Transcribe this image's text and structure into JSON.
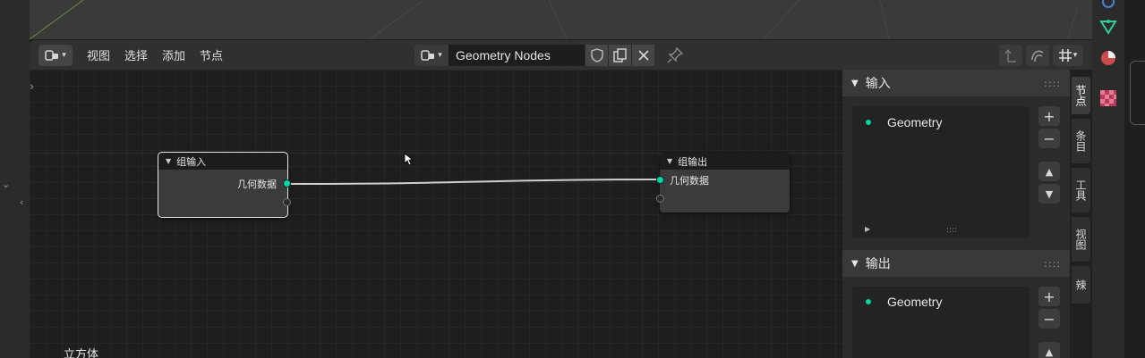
{
  "header": {
    "menus": [
      "视图",
      "选择",
      "添加",
      "节点"
    ],
    "tree_name": "Geometry Nodes"
  },
  "nodes": {
    "group_input": {
      "title": "组输入",
      "output": "几何数据"
    },
    "group_output": {
      "title": "组输出",
      "input": "几何数据"
    }
  },
  "canvas": {
    "label": "立方体"
  },
  "sidebar": {
    "inputs_title": "输入",
    "inputs_item": "Geometry",
    "outputs_title": "输出",
    "outputs_item": "Geometry"
  },
  "tabs": [
    "节点",
    "条目",
    "工具",
    "视图",
    "辣"
  ],
  "colors": {
    "geometry_socket": "#00d6a3",
    "accent": "#4772b3"
  }
}
